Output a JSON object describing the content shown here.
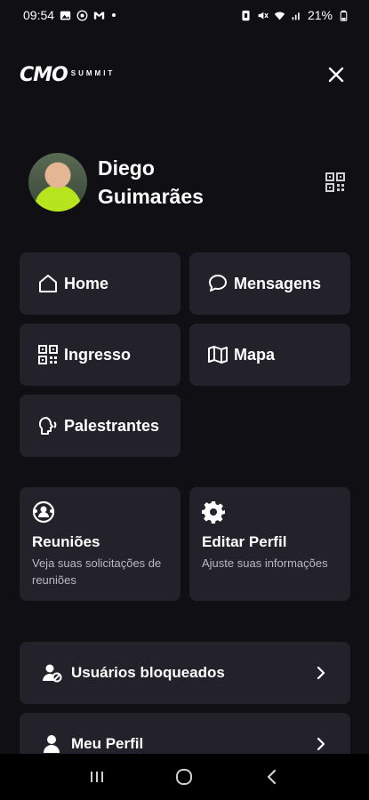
{
  "status_bar": {
    "time": "09:54",
    "battery": "21%"
  },
  "header": {
    "logo_main": "CMO",
    "logo_sub": "SUMMIT"
  },
  "profile": {
    "name": "Diego Guimarães"
  },
  "nav": {
    "home": "Home",
    "messages": "Mensagens",
    "ticket": "Ingresso",
    "map": "Mapa",
    "speakers": "Palestrantes"
  },
  "cards": {
    "meetings_title": "Reuniões",
    "meetings_desc": "Veja suas solicitações de reuniões",
    "edit_profile_title": "Editar Perfil",
    "edit_profile_desc": "Ajuste suas informações"
  },
  "list": {
    "blocked_users": "Usuários bloqueados",
    "my_profile": "Meu Perfil"
  },
  "colors": {
    "background": "#0f0f14",
    "card": "#23222a",
    "text": "#ffffff",
    "muted": "#b9b9c0"
  }
}
